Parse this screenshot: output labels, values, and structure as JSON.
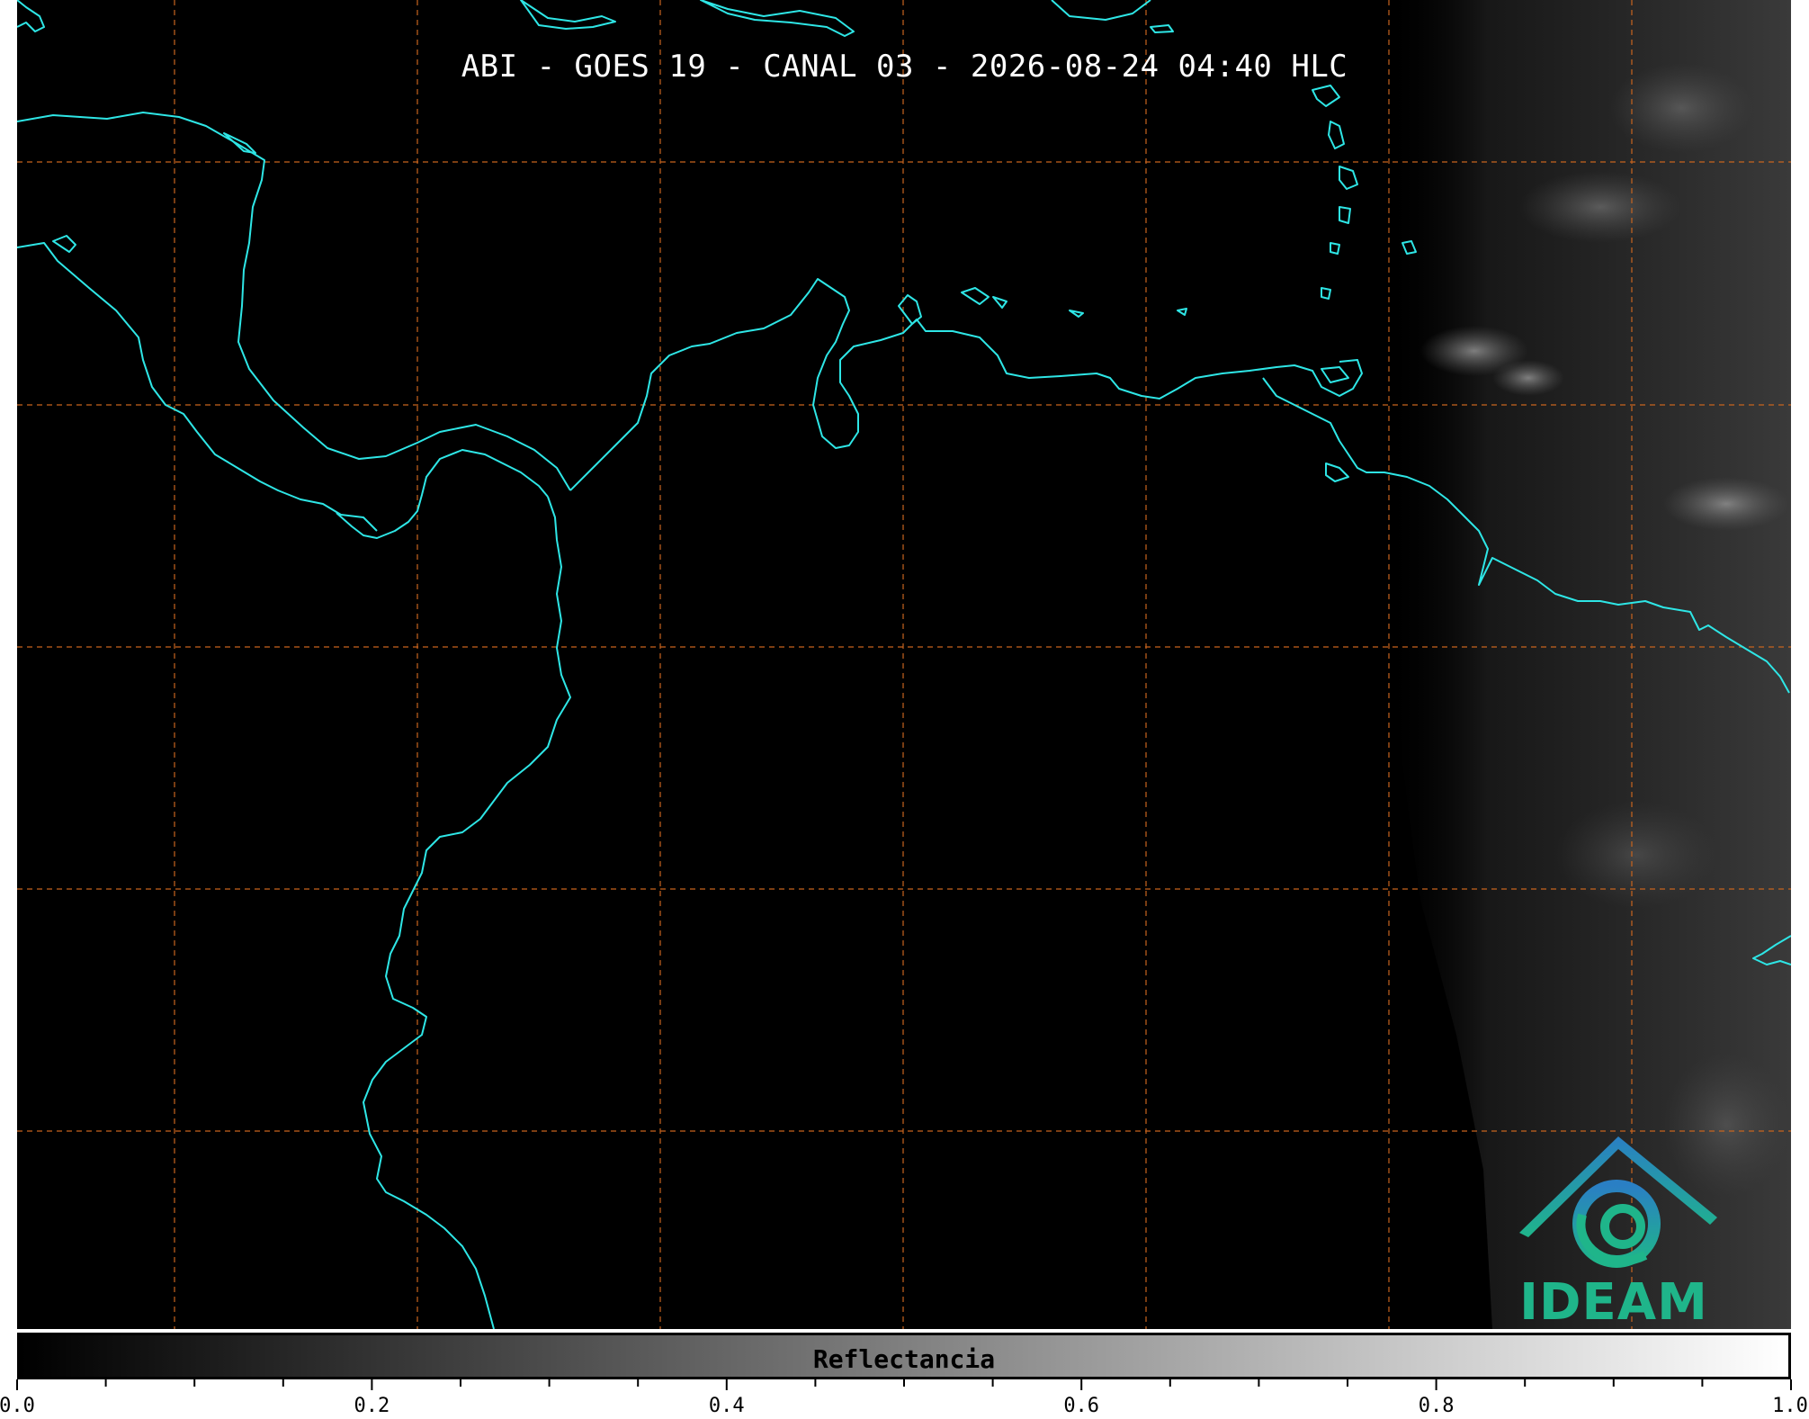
{
  "map": {
    "title": "ABI - GOES 19 - CANAL 03 - 2026-08-24 04:40 HLC",
    "background_color": "#000000",
    "coastline_color": "#2ee6e6",
    "gridline_color": "#c8641e",
    "gridline_style": "dashed",
    "cloud_region_side": "right",
    "logo": {
      "text": "IDEAM",
      "text_color": "#1fb58a",
      "emblem_colors": [
        "#2a7fc4",
        "#1fb58a"
      ]
    }
  },
  "colorbar": {
    "label": "Reflectancia",
    "colormap": "grayscale",
    "range": [
      0.0,
      1.0
    ],
    "tick_labels": [
      "0.0",
      "0.2",
      "0.4",
      "0.6",
      "0.8",
      "1.0"
    ]
  }
}
